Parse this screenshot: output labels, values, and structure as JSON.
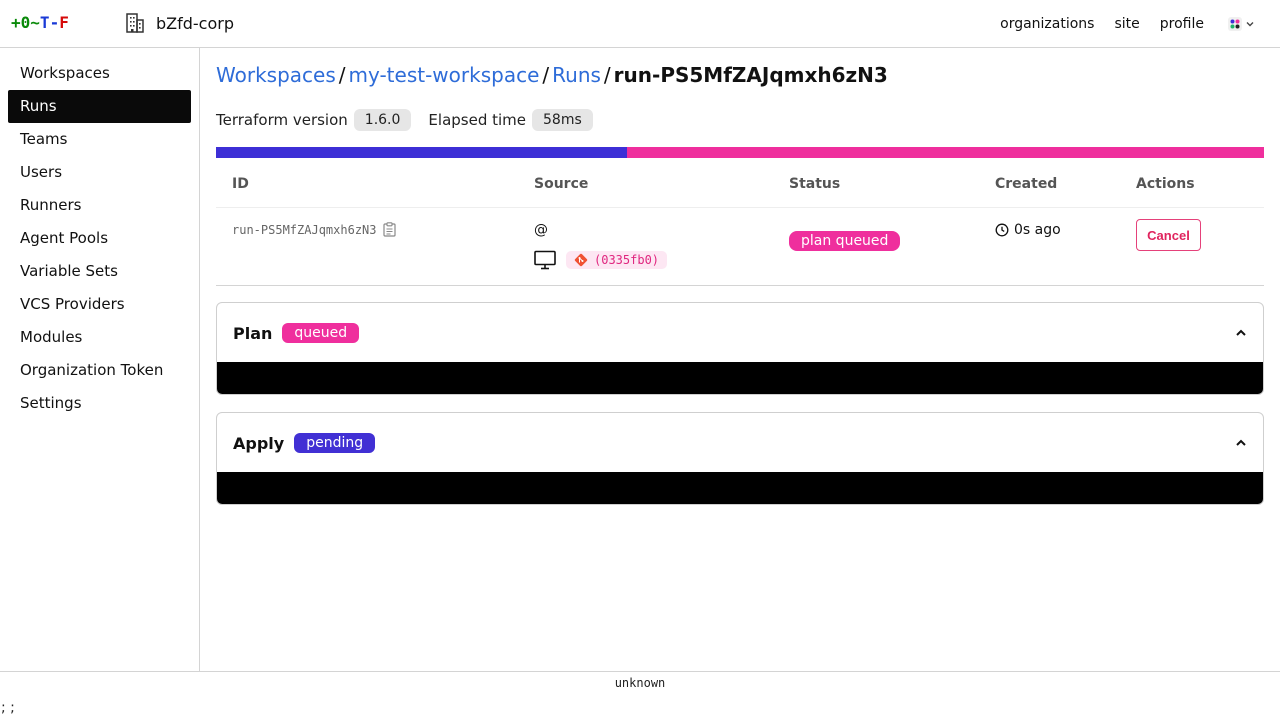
{
  "logo": {
    "parts": [
      "+",
      "0",
      "~",
      "T",
      "-",
      "F"
    ],
    "colors": [
      "#0a8a0a",
      "#0a8a0a",
      "#0a8a0a",
      "#1a3ad6",
      "#1a3ad6",
      "#d60a0a"
    ]
  },
  "header": {
    "org_name": "bZfd-corp",
    "nav": {
      "organizations": "organizations",
      "site": "site",
      "profile": "profile"
    }
  },
  "sidebar": {
    "items": [
      {
        "label": "Workspaces"
      },
      {
        "label": "Runs",
        "active": true
      },
      {
        "label": "Teams"
      },
      {
        "label": "Users"
      },
      {
        "label": "Runners"
      },
      {
        "label": "Agent Pools"
      },
      {
        "label": "Variable Sets"
      },
      {
        "label": "VCS Providers"
      },
      {
        "label": "Modules"
      },
      {
        "label": "Organization Token"
      },
      {
        "label": "Settings"
      }
    ]
  },
  "breadcrumb": {
    "workspaces": "Workspaces",
    "workspace": "my-test-workspace",
    "runs": "Runs",
    "current": "run-PS5MfZAJqmxh6zN3",
    "separator": "/"
  },
  "meta": {
    "tf_label": "Terraform version",
    "tf_value": "1.6.0",
    "elapsed_label": "Elapsed time",
    "elapsed_value": "58ms"
  },
  "progress": {
    "plan_fraction": 0.392,
    "colors": [
      "#3d2fd6",
      "#ef2f9d"
    ]
  },
  "table": {
    "headers": {
      "id": "ID",
      "source": "Source",
      "status": "Status",
      "created": "Created",
      "actions": "Actions"
    },
    "row": {
      "id": "run-PS5MfZAJqmxh6zN3",
      "source_at": "@",
      "commit": "(0335fb0)",
      "status": "plan queued",
      "created": "0s ago",
      "action": "Cancel"
    }
  },
  "plan": {
    "title": "Plan",
    "status": "queued",
    "status_color": "#ef2f9d"
  },
  "apply": {
    "title": "Apply",
    "status": "pending",
    "status_color": "#4130d4"
  },
  "footer": {
    "version": "unknown",
    "extra": "; ;"
  }
}
